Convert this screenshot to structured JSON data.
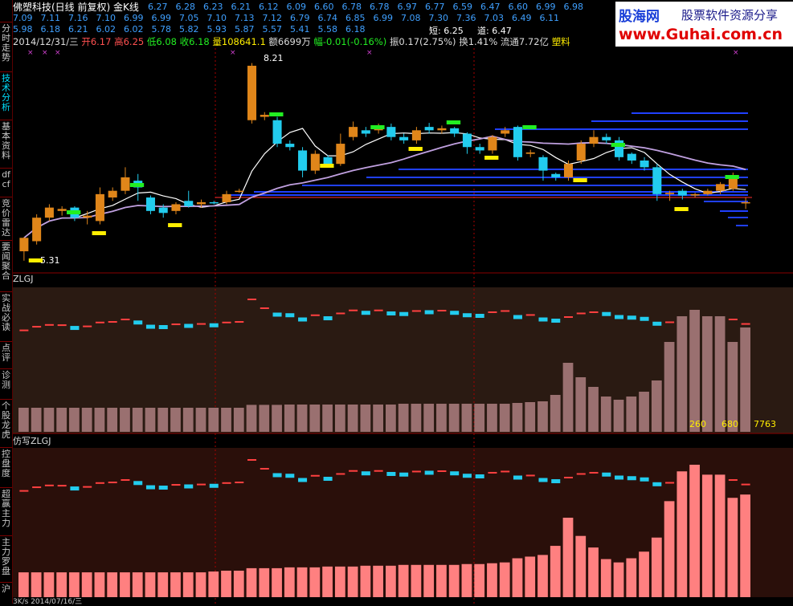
{
  "sidebar": [
    {
      "label": "分时走势",
      "active": false
    },
    {
      "label": "技术分析",
      "active": true
    },
    {
      "label": "基本资料",
      "active": false
    },
    {
      "label": "dfcf",
      "active": false
    },
    {
      "label": "竞价雷达",
      "active": false
    },
    {
      "label": "要闻聚合",
      "active": false
    },
    {
      "label": "实战必读",
      "active": false
    },
    {
      "label": "点评",
      "active": false
    },
    {
      "label": "诊测",
      "active": false
    },
    {
      "label": "个股龙虎",
      "active": false
    },
    {
      "label": "控盘度",
      "active": false
    },
    {
      "label": "超赢主力",
      "active": false
    },
    {
      "label": "主力罗盘",
      "active": false
    },
    {
      "label": "沪",
      "active": false
    }
  ],
  "header": {
    "title": "佛塑科技(日线 前复权) 金K线",
    "row1": [
      "6.27",
      "6.28",
      "6.23",
      "6.21",
      "6.12",
      "6.09",
      "6.60",
      "6.78",
      "6.78",
      "6.97",
      "6.77",
      "6.59",
      "6.47",
      "6.60",
      "6.99",
      "6.98"
    ],
    "row2": [
      "7.09",
      "7.11",
      "7.16",
      "7.10",
      "6.99",
      "6.99",
      "7.05",
      "7.10",
      "7.13",
      "7.12",
      "6.79",
      "6.74",
      "6.85",
      "6.99",
      "7.08",
      "7.30",
      "7.36",
      "7.03",
      "6.49",
      "6.11"
    ],
    "row3": [
      "5.98",
      "6.18",
      "6.21",
      "6.02",
      "6.02",
      "5.78",
      "5.82",
      "5.93",
      "5.87",
      "5.57",
      "5.41",
      "5.58",
      "6.18"
    ],
    "short_label": "短: 6.25",
    "dao_label": "道: 6.47"
  },
  "info_line": {
    "date": "2014/12/31/三",
    "open": "开6.17",
    "high": "高6.25",
    "low": "低6.08",
    "close": "收6.18",
    "volume": "量108641.1",
    "amount": "额6699万",
    "change": "幅-0.01(-0.16%)",
    "amplitude": "振0.17(2.75%)",
    "turnover": "换1.41%",
    "float": "流通7.72亿",
    "sector": "塑料"
  },
  "logo": {
    "cn": "股海网",
    "sub": "股票软件资源分享",
    "url": "www.Guhai.com.cn"
  },
  "chart_annotations": {
    "max_label": "8.21",
    "min_label": "5.31"
  },
  "panels": {
    "zlgj": {
      "label": "ZLGJ",
      "values_text": [
        "260",
        "680",
        "7763"
      ]
    },
    "fangxie": {
      "label": "仿写ZLGJ"
    }
  },
  "bottom": {
    "text": "3K/s    2014/07/16/三"
  },
  "colors": {
    "up": "#e0861a",
    "down": "#22ccee",
    "ma_short": "#ffffff",
    "ma_long": "#c0a0e0",
    "ma_red": "#e02050",
    "blue_bars": "#2040ff",
    "panel_bg": "#2a1a12",
    "panel2_bg": "#2a0f0a",
    "bar1": "#9a7070",
    "bar2": "#ff8080",
    "yellow": "#ffee00",
    "green": "#22ee22"
  },
  "chart_data": {
    "type": "candlestick",
    "candles": [
      {
        "o": 5.45,
        "c": 5.65,
        "h": 5.66,
        "l": 5.31
      },
      {
        "o": 5.6,
        "c": 5.95,
        "h": 6.0,
        "l": 5.55
      },
      {
        "o": 5.95,
        "c": 6.1,
        "h": 6.15,
        "l": 5.9
      },
      {
        "o": 6.05,
        "c": 6.08,
        "h": 6.12,
        "l": 5.98
      },
      {
        "o": 6.1,
        "c": 5.95,
        "h": 6.12,
        "l": 5.9
      },
      {
        "o": 5.95,
        "c": 5.98,
        "h": 6.05,
        "l": 5.85
      },
      {
        "o": 5.9,
        "c": 6.3,
        "h": 6.4,
        "l": 5.85
      },
      {
        "o": 6.25,
        "c": 6.35,
        "h": 6.4,
        "l": 6.2
      },
      {
        "o": 6.35,
        "c": 6.55,
        "h": 6.7,
        "l": 6.3
      },
      {
        "o": 6.5,
        "c": 6.4,
        "h": 6.6,
        "l": 6.2
      },
      {
        "o": 6.25,
        "c": 6.05,
        "h": 6.28,
        "l": 6.0
      },
      {
        "o": 6.1,
        "c": 6.02,
        "h": 6.15,
        "l": 5.95
      },
      {
        "o": 6.05,
        "c": 6.15,
        "h": 6.18,
        "l": 6.0
      },
      {
        "o": 6.2,
        "c": 6.12,
        "h": 6.35,
        "l": 6.1
      },
      {
        "o": 6.15,
        "c": 6.18,
        "h": 6.22,
        "l": 6.1
      },
      {
        "o": 6.18,
        "c": 6.17,
        "h": 6.2,
        "l": 6.15
      },
      {
        "o": 6.18,
        "c": 6.3,
        "h": 6.35,
        "l": 6.15
      },
      {
        "o": 6.35,
        "c": 6.35,
        "h": 6.38,
        "l": 6.32
      },
      {
        "o": 7.4,
        "c": 8.21,
        "h": 8.25,
        "l": 7.35
      },
      {
        "o": 7.45,
        "c": 7.48,
        "h": 7.52,
        "l": 7.4
      },
      {
        "o": 7.4,
        "c": 7.05,
        "h": 7.45,
        "l": 7.0
      },
      {
        "o": 7.05,
        "c": 7.0,
        "h": 7.1,
        "l": 6.95
      },
      {
        "o": 6.95,
        "c": 6.65,
        "h": 7.0,
        "l": 6.55
      },
      {
        "o": 6.65,
        "c": 6.9,
        "h": 6.95,
        "l": 6.6
      },
      {
        "o": 6.85,
        "c": 6.75,
        "h": 6.88,
        "l": 6.7
      },
      {
        "o": 6.75,
        "c": 7.05,
        "h": 7.2,
        "l": 6.72
      },
      {
        "o": 7.15,
        "c": 7.3,
        "h": 7.38,
        "l": 7.1
      },
      {
        "o": 7.25,
        "c": 7.2,
        "h": 7.3,
        "l": 7.15
      },
      {
        "o": 7.25,
        "c": 7.3,
        "h": 7.35,
        "l": 7.2
      },
      {
        "o": 7.3,
        "c": 7.15,
        "h": 7.35,
        "l": 7.1
      },
      {
        "o": 7.15,
        "c": 7.1,
        "h": 7.2,
        "l": 7.05
      },
      {
        "o": 7.1,
        "c": 7.25,
        "h": 7.3,
        "l": 7.05
      },
      {
        "o": 7.3,
        "c": 7.25,
        "h": 7.36,
        "l": 7.2
      },
      {
        "o": 7.25,
        "c": 7.28,
        "h": 7.32,
        "l": 7.2
      },
      {
        "o": 7.28,
        "c": 7.2,
        "h": 7.3,
        "l": 7.15
      },
      {
        "o": 7.2,
        "c": 7.0,
        "h": 7.22,
        "l": 6.9
      },
      {
        "o": 7.0,
        "c": 6.95,
        "h": 7.05,
        "l": 6.9
      },
      {
        "o": 6.95,
        "c": 7.15,
        "h": 7.18,
        "l": 6.9
      },
      {
        "o": 7.2,
        "c": 7.25,
        "h": 7.3,
        "l": 7.15
      },
      {
        "o": 7.3,
        "c": 6.85,
        "h": 7.32,
        "l": 6.8
      },
      {
        "o": 6.9,
        "c": 6.92,
        "h": 6.96,
        "l": 6.85
      },
      {
        "o": 6.85,
        "c": 6.65,
        "h": 6.88,
        "l": 6.5
      },
      {
        "o": 6.6,
        "c": 6.55,
        "h": 6.62,
        "l": 6.5
      },
      {
        "o": 6.55,
        "c": 6.75,
        "h": 6.8,
        "l": 6.5
      },
      {
        "o": 6.8,
        "c": 7.05,
        "h": 7.1,
        "l": 6.75
      },
      {
        "o": 7.05,
        "c": 7.15,
        "h": 7.25,
        "l": 7.0
      },
      {
        "o": 7.15,
        "c": 7.1,
        "h": 7.2,
        "l": 7.05
      },
      {
        "o": 7.1,
        "c": 6.85,
        "h": 7.15,
        "l": 6.8
      },
      {
        "o": 6.9,
        "c": 6.8,
        "h": 6.92,
        "l": 6.75
      },
      {
        "o": 6.8,
        "c": 6.7,
        "h": 6.85,
        "l": 6.65
      },
      {
        "o": 6.7,
        "c": 6.3,
        "h": 6.75,
        "l": 6.2
      },
      {
        "o": 6.3,
        "c": 6.32,
        "h": 6.35,
        "l": 6.2
      },
      {
        "o": 6.35,
        "c": 6.28,
        "h": 6.38,
        "l": 6.22
      },
      {
        "o": 6.28,
        "c": 6.3,
        "h": 6.32,
        "l": 6.25
      },
      {
        "o": 6.3,
        "c": 6.35,
        "h": 6.38,
        "l": 6.28
      },
      {
        "o": 6.35,
        "c": 6.45,
        "h": 6.48,
        "l": 6.3
      },
      {
        "o": 6.38,
        "c": 6.55,
        "h": 6.62,
        "l": 6.35
      },
      {
        "o": 6.17,
        "c": 6.18,
        "h": 6.25,
        "l": 6.08
      }
    ],
    "ylim": [
      5.2,
      8.4
    ],
    "zlgj_bars": [
      150,
      150,
      150,
      150,
      150,
      150,
      150,
      150,
      150,
      150,
      150,
      150,
      150,
      150,
      150,
      150,
      150,
      150,
      168,
      168,
      168,
      170,
      170,
      170,
      170,
      170,
      170,
      170,
      170,
      170,
      175,
      175,
      175,
      175,
      175,
      175,
      175,
      175,
      175,
      180,
      185,
      190,
      230,
      430,
      340,
      280,
      220,
      200,
      220,
      250,
      320,
      560,
      720,
      760,
      720,
      720,
      560,
      650
    ],
    "fangxie_bars": [
      150,
      150,
      150,
      150,
      150,
      150,
      150,
      150,
      150,
      150,
      150,
      150,
      150,
      150,
      150,
      155,
      160,
      160,
      175,
      175,
      175,
      180,
      180,
      180,
      185,
      185,
      185,
      190,
      190,
      190,
      195,
      195,
      195,
      195,
      195,
      200,
      200,
      205,
      210,
      235,
      245,
      255,
      310,
      480,
      370,
      300,
      230,
      210,
      235,
      275,
      360,
      580,
      760,
      800,
      740,
      740,
      600,
      620
    ]
  }
}
